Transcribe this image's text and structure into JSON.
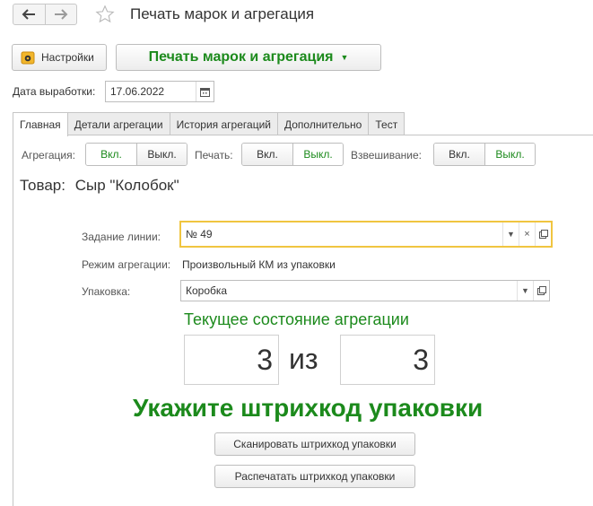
{
  "window": {
    "title": "Печать марок и агрегация"
  },
  "toolbar": {
    "settings_label": "Настройки",
    "main_label": "Печать марок и агрегация"
  },
  "date": {
    "label": "Дата выработки:",
    "value": "17.06.2022"
  },
  "tabs": [
    {
      "label": "Главная",
      "active": true
    },
    {
      "label": "Детали агрегации",
      "active": false
    },
    {
      "label": "История агрегаций",
      "active": false
    },
    {
      "label": "Дополнительно",
      "active": false
    },
    {
      "label": "Тест",
      "active": false
    }
  ],
  "toggles": {
    "aggregation": {
      "label": "Агрегация:",
      "on_label": "Вкл.",
      "off_label": "Выкл.",
      "selected": "on"
    },
    "print": {
      "label": "Печать:",
      "on_label": "Вкл.",
      "off_label": "Выкл.",
      "selected": "off"
    },
    "weighing": {
      "label": "Взвешивание:",
      "on_label": "Вкл.",
      "off_label": "Выкл.",
      "selected": "off"
    }
  },
  "product": {
    "label": "Товар:",
    "value": "Сыр \"Колобок\""
  },
  "form": {
    "task_label": "Задание линии:",
    "task_value": "№ 49",
    "mode_label": "Режим агрегации:",
    "mode_value": "Произвольный КМ из упаковки",
    "pack_label": "Упаковка:",
    "pack_value": "Коробка"
  },
  "state": {
    "title": "Текущее состояние агрегации",
    "current": "3",
    "separator": "из",
    "total": "3"
  },
  "prompt": "Укажите штрихкод упаковки",
  "actions": {
    "scan_label": "Сканировать штрихкод упаковки",
    "print_label": "Распечатать штрихкод упаковки"
  },
  "colors": {
    "accent_green": "#1c8a1c",
    "focus_yellow": "#f0c540"
  }
}
